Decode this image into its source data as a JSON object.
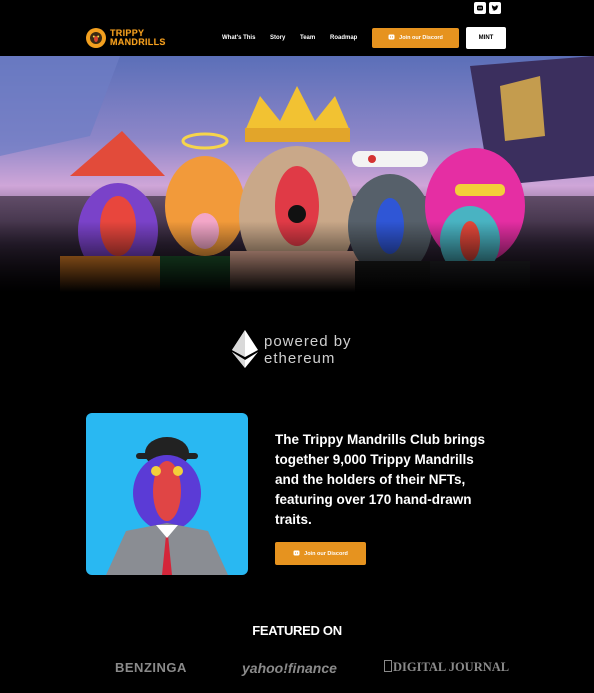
{
  "social": {
    "icons": [
      "discord-icon",
      "twitter-icon"
    ]
  },
  "header": {
    "logo_line1": "TRIPPY",
    "logo_line2": "MANDRILLS",
    "nav": [
      "What's This",
      "Story",
      "Team",
      "Roadmap"
    ],
    "discord_button": "Join our Discord",
    "mint_button": "MINT"
  },
  "powered": {
    "line1": "powered by",
    "line2": "ethereum"
  },
  "feature": {
    "description": "The Trippy Mandrills Club brings together 9,000 Trippy Mandrills and the holders of their NFTs, featuring over 170 hand-drawn traits.",
    "discord_button": "Join our Discord"
  },
  "featured": {
    "title": "FEATURED ON",
    "outlets": [
      "BENZINGA",
      "yahoo!finance",
      "DIGITAL JOURNAL"
    ]
  },
  "colors": {
    "accent": "#e6931f",
    "feature_bg": "#29b8f2",
    "background": "#000000"
  }
}
